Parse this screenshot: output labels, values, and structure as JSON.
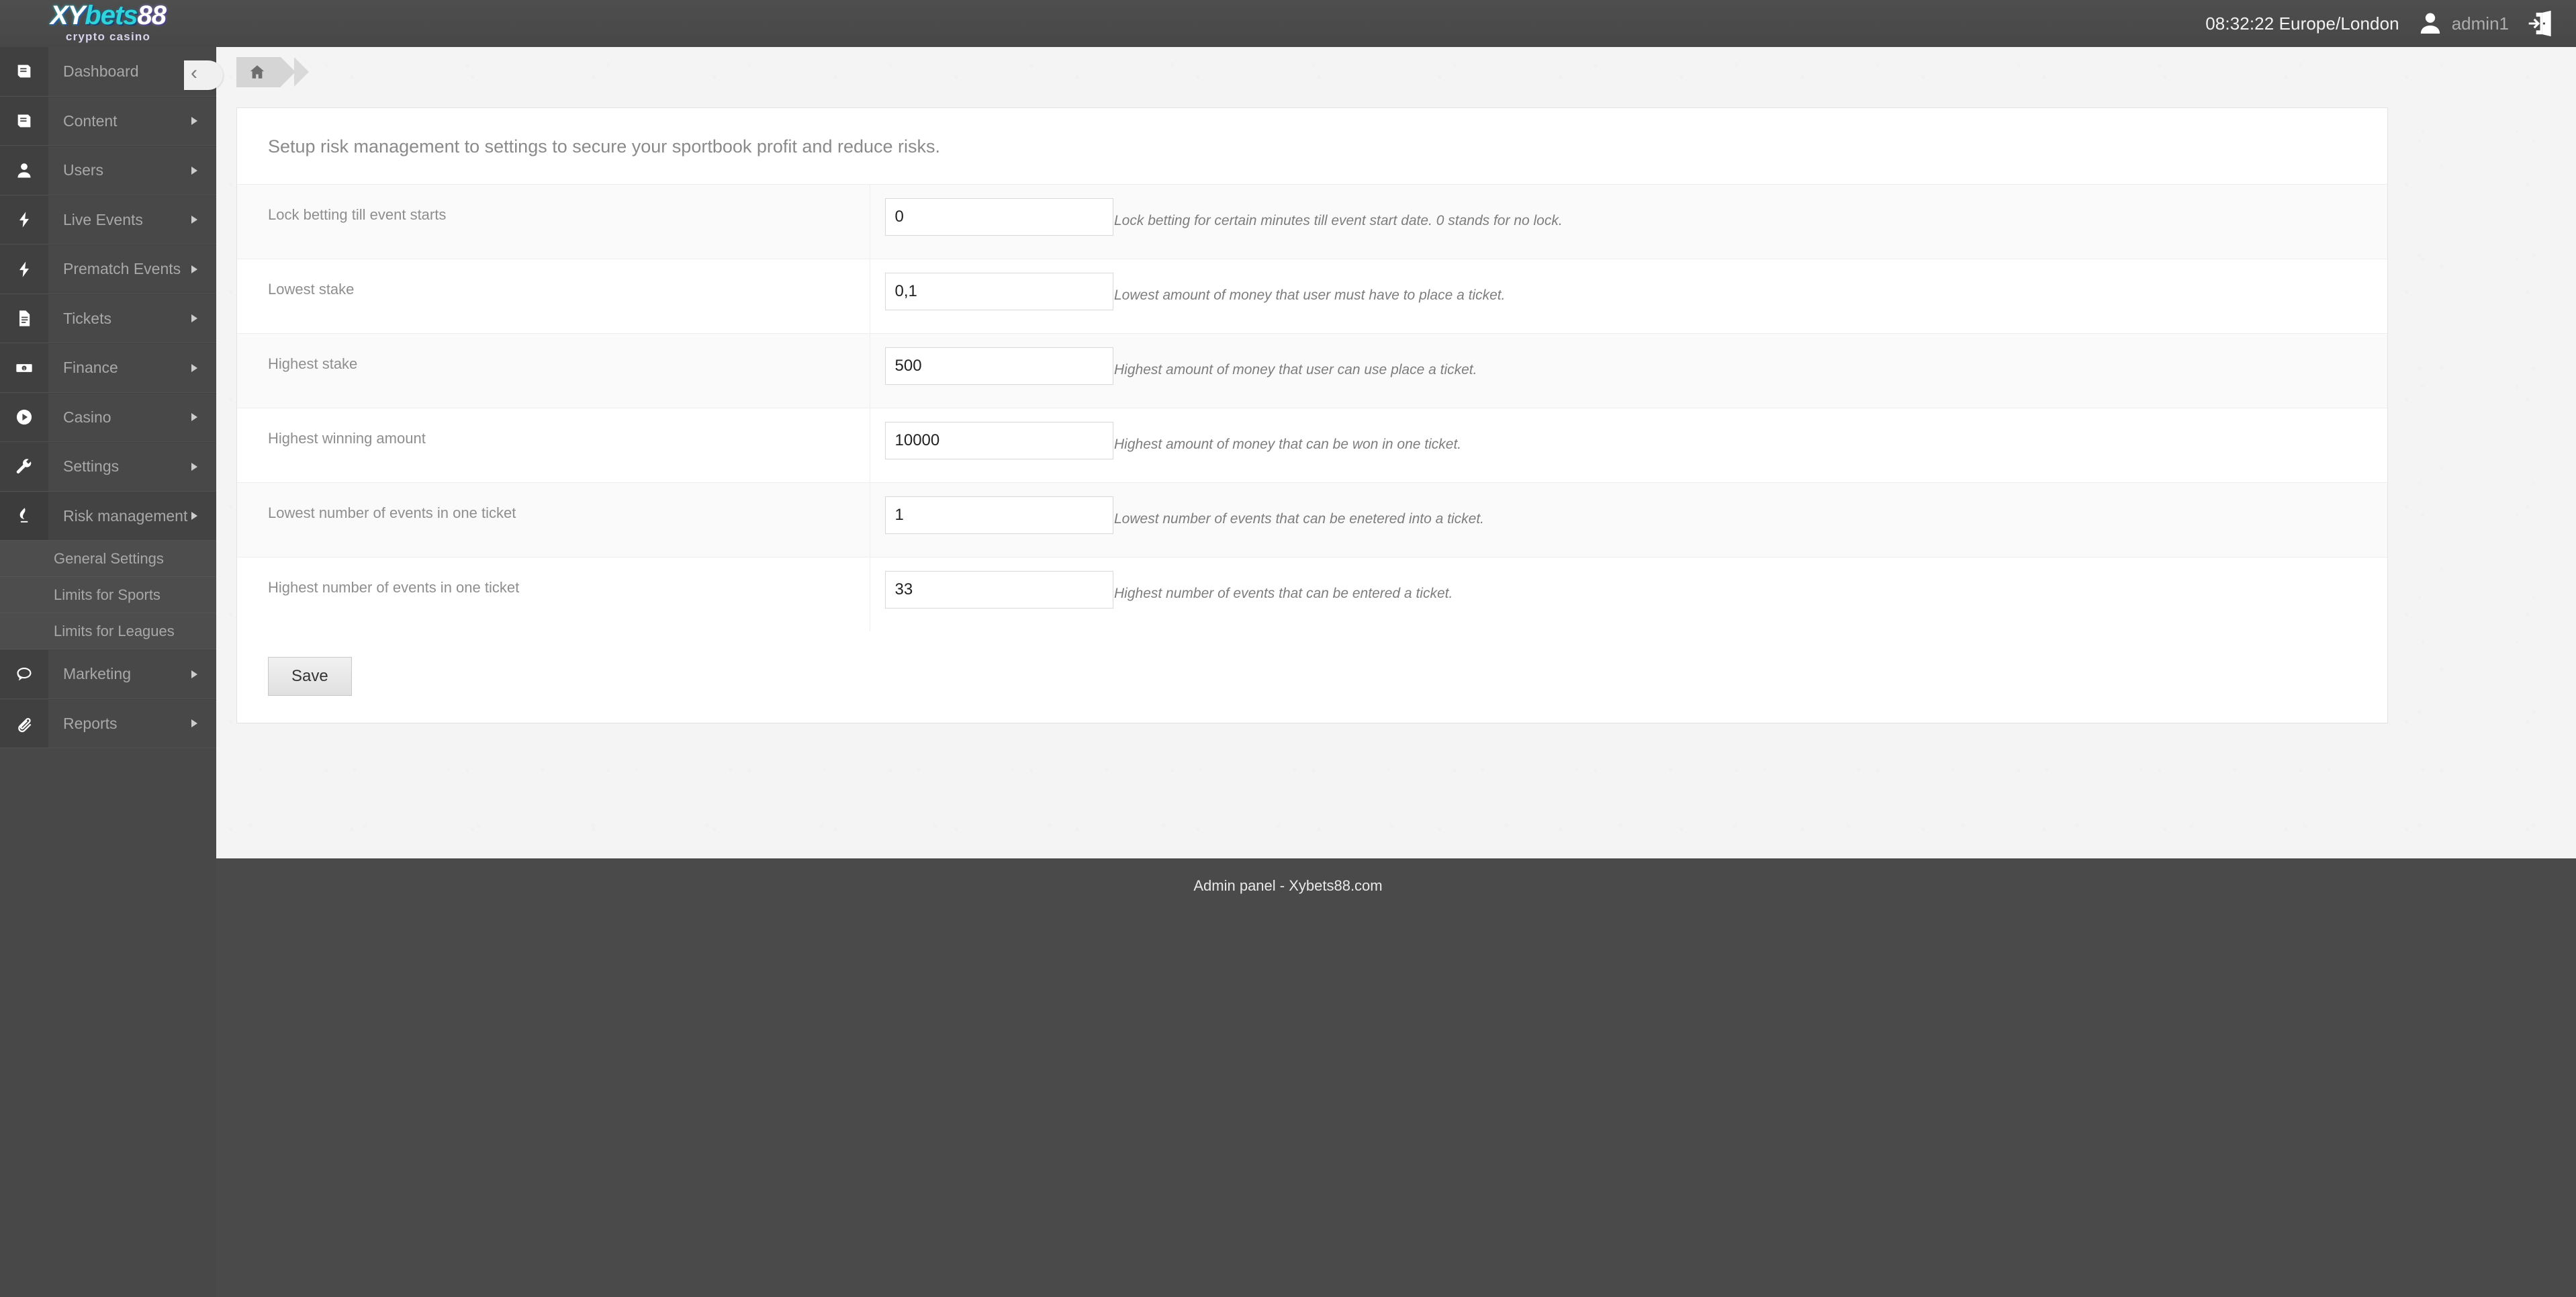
{
  "brand": {
    "logo_xy": "XY",
    "logo_bets": "bets",
    "logo_88": "88",
    "logo_sub": "crypto casino"
  },
  "topbar": {
    "clock": "08:32:22 Europe/London",
    "username": "admin1",
    "avatar_icon": "user-avatar-icon",
    "logout_icon": "logout-door-icon"
  },
  "sidebar": {
    "items": [
      {
        "label": "Dashboard",
        "icon": "book-icon"
      },
      {
        "label": "Content",
        "icon": "book-icon"
      },
      {
        "label": "Users",
        "icon": "user-icon"
      },
      {
        "label": "Live Events",
        "icon": "bolt-icon"
      },
      {
        "label": "Prematch Events",
        "icon": "bolt-icon"
      },
      {
        "label": "Tickets",
        "icon": "document-icon"
      },
      {
        "label": "Finance",
        "icon": "banknote-icon"
      },
      {
        "label": "Casino",
        "icon": "play-circle-icon"
      },
      {
        "label": "Settings",
        "icon": "wrench-icon"
      },
      {
        "label": "Risk management",
        "icon": "flame-icon"
      },
      {
        "label": "Marketing",
        "icon": "speech-bubble-icon"
      },
      {
        "label": "Reports",
        "icon": "paperclip-icon"
      }
    ],
    "risk_submenu": [
      {
        "label": "General Settings"
      },
      {
        "label": "Limits for Sports"
      },
      {
        "label": "Limits for Leagues"
      }
    ]
  },
  "breadcrumb": {
    "home_icon": "home-icon",
    "collapse_icon": "‹"
  },
  "main": {
    "heading": "Setup risk management to settings to secure your sportbook profit and reduce risks.",
    "rows": [
      {
        "label": "Lock betting till event starts",
        "value": "0",
        "help": "Lock betting for certain minutes till event start date. 0 stands for no lock."
      },
      {
        "label": "Lowest stake",
        "value": "0,1",
        "help": "Lowest amount of money that user must have to place a ticket."
      },
      {
        "label": "Highest stake",
        "value": "500",
        "help": "Highest amount of money that user can use place a ticket."
      },
      {
        "label": "Highest winning amount",
        "value": "10000",
        "help": "Highest amount of money that can be won in one ticket."
      },
      {
        "label": "Lowest number of events in one ticket",
        "value": "1",
        "help": "Lowest number of events that can be enetered into a ticket."
      },
      {
        "label": "Highest number of events in one ticket",
        "value": "33",
        "help": "Highest number of events that can be entered a ticket."
      }
    ],
    "save_label": "Save"
  },
  "footer": {
    "text": "Admin panel - Xybets88.com"
  }
}
